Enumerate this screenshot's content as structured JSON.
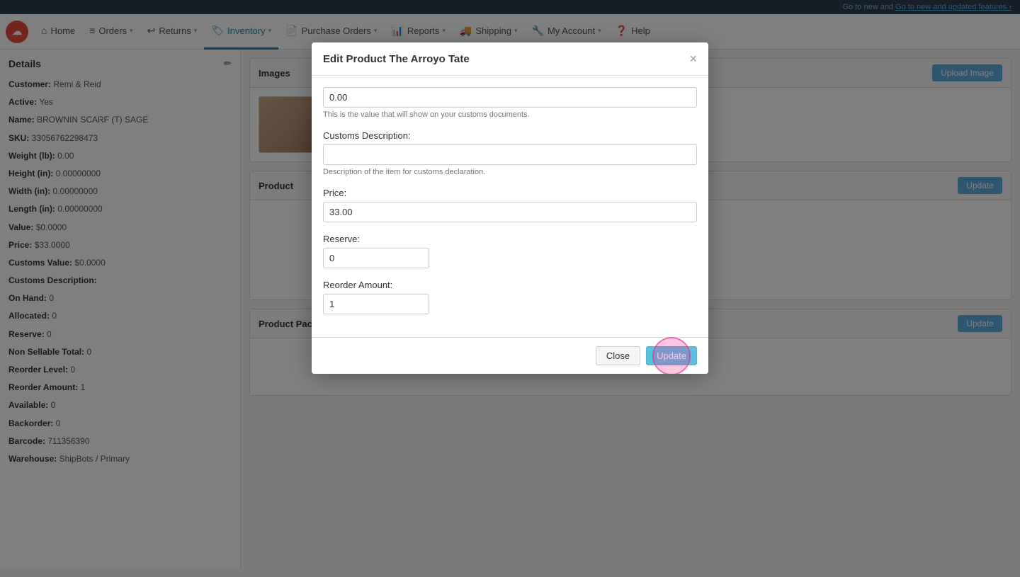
{
  "topBanner": {
    "text": "Go to new and updated features",
    "prefix": ""
  },
  "navbar": {
    "logo": "☁",
    "items": [
      {
        "id": "home",
        "label": "Home",
        "icon": "⌂",
        "active": false,
        "hasCaret": false
      },
      {
        "id": "orders",
        "label": "Orders",
        "icon": "📋",
        "active": false,
        "hasCaret": true
      },
      {
        "id": "returns",
        "label": "Returns",
        "icon": "↩",
        "active": false,
        "hasCaret": true
      },
      {
        "id": "inventory",
        "label": "Inventory",
        "icon": "🏷",
        "active": true,
        "hasCaret": true
      },
      {
        "id": "purchase-orders",
        "label": "Purchase Orders",
        "icon": "📄",
        "active": false,
        "hasCaret": true
      },
      {
        "id": "reports",
        "label": "Reports",
        "icon": "📊",
        "active": false,
        "hasCaret": true
      },
      {
        "id": "shipping",
        "label": "Shipping",
        "icon": "🚚",
        "active": false,
        "hasCaret": true
      },
      {
        "id": "my-account",
        "label": "My Account",
        "icon": "🔧",
        "active": false,
        "hasCaret": true
      },
      {
        "id": "help",
        "label": "Help",
        "icon": "❓",
        "active": false,
        "hasCaret": false
      }
    ]
  },
  "leftPanel": {
    "title": "Details",
    "fields": [
      {
        "label": "Customer:",
        "value": "Remi & Reid"
      },
      {
        "label": "Active:",
        "value": "Yes"
      },
      {
        "label": "Name:",
        "value": "BROWNIN SCARF (T) SAGE"
      },
      {
        "label": "SKU:",
        "value": "33056762298473"
      },
      {
        "label": "Weight (lb):",
        "value": "0.00"
      },
      {
        "label": "Height (in):",
        "value": "0.00000000"
      },
      {
        "label": "Width (in):",
        "value": "0.00000000"
      },
      {
        "label": "Length (in):",
        "value": "0.00000000"
      },
      {
        "label": "Value:",
        "value": "$0.0000"
      },
      {
        "label": "Price:",
        "value": "$33.0000"
      },
      {
        "label": "Customs Value:",
        "value": "$0.0000"
      },
      {
        "label": "Customs Description:",
        "value": ""
      },
      {
        "label": "On Hand:",
        "value": "0"
      },
      {
        "label": "Allocated:",
        "value": "0"
      },
      {
        "label": "Reserve:",
        "value": "0"
      },
      {
        "label": "Non Sellable Total:",
        "value": "0"
      },
      {
        "label": "Reorder Level:",
        "value": "0"
      },
      {
        "label": "Reorder Amount:",
        "value": "1"
      },
      {
        "label": "Available:",
        "value": "0"
      },
      {
        "label": "Backorder:",
        "value": "0"
      },
      {
        "label": "Barcode:",
        "value": "711356390"
      },
      {
        "label": "Warehouse:",
        "value": "ShipBots / Primary"
      }
    ]
  },
  "rightPanel": {
    "imagesSection": {
      "title": "Images",
      "uploadButtonLabel": "Upload Image"
    },
    "productSection": {
      "title": "Product"
    },
    "productPackerNote": {
      "title": "Product Packer Note",
      "updateButtonLabel": "Update"
    }
  },
  "modal": {
    "title": "Edit Product The Arroyo Tate",
    "closeLabel": "×",
    "fields": [
      {
        "id": "customs-value",
        "label": "",
        "value": "0.00",
        "hint": "This is the value that will show on your customs documents.",
        "type": "text"
      },
      {
        "id": "customs-description",
        "label": "Customs Description:",
        "value": "",
        "hint": "Description of the item for customs declaration.",
        "type": "text"
      },
      {
        "id": "price",
        "label": "Price:",
        "value": "33.00",
        "hint": "",
        "type": "text"
      },
      {
        "id": "reserve",
        "label": "Reserve:",
        "value": "0",
        "hint": "",
        "type": "text",
        "small": true
      },
      {
        "id": "reorder-amount",
        "label": "Reorder Amount:",
        "value": "1",
        "hint": "",
        "type": "text",
        "small": true
      }
    ],
    "closeButtonLabel": "Close",
    "updateButtonLabel": "Update"
  }
}
